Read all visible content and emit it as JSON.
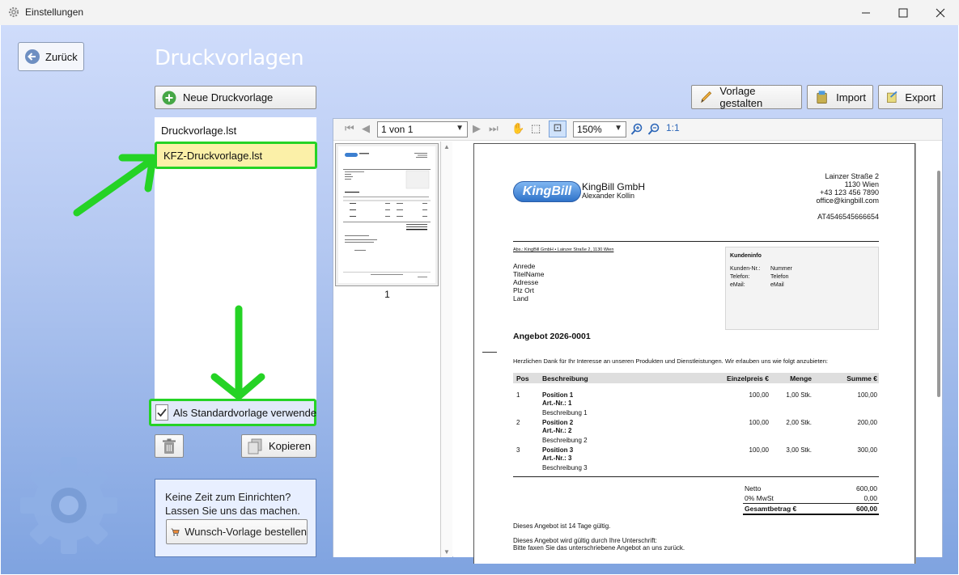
{
  "window": {
    "title": "Einstellungen",
    "minimize_icon": "minimize-icon",
    "maximize_icon": "maximize-icon",
    "close_icon": "close-icon"
  },
  "nav": {
    "back_label": "Zurück"
  },
  "page_title": "Druckvorlagen",
  "toolbar": {
    "new_label": "Neue Druckvorlage",
    "design_label": "Vorlage gestalten",
    "import_label": "Import",
    "export_label": "Export"
  },
  "templates": {
    "items": [
      {
        "label": "Druckvorlage.lst"
      },
      {
        "label": "KFZ-Druckvorlage.lst"
      }
    ],
    "selected_index": 1
  },
  "default_checkbox": {
    "label": "Als Standardvorlage verwende",
    "checked": true
  },
  "actions": {
    "copy_label": "Kopieren"
  },
  "info": {
    "line1": "Keine Zeit zum Einrichten?",
    "line2": "Lassen Sie uns das machen.",
    "order_label": "Wunsch-Vorlage bestellen"
  },
  "preview": {
    "page_select": "1 von 1",
    "zoom_select": "150%",
    "zoom_reset": "1:1",
    "thumb_page_number": "1"
  },
  "document": {
    "company": "KingBill GmbH",
    "logo_text": "KingBill",
    "contact_name": "Alexander Kollin",
    "address": [
      "Lainzer Straße 2",
      "1130 Wien",
      "+43 123 456 7890",
      "office@kingbill.com"
    ],
    "vat_id": "AT4546545666654",
    "sender_line": "Abs.: KingBill GmbH • Lainzer Straße 2, 1130 Wien",
    "recipient": [
      "Anrede",
      "TitelName",
      "Adresse",
      "Plz Ort",
      "Land"
    ],
    "customer_box": {
      "title": "Kundeninfo",
      "rows": [
        {
          "label": "Kunden-Nr.:",
          "value": "Nummer"
        },
        {
          "label": "Telefon:",
          "value": "Telefon"
        },
        {
          "label": "eMail:",
          "value": "eMail"
        }
      ]
    },
    "heading": "Angebot 2026-0001",
    "intro": "Herzlichen Dank für Ihr Interesse an unseren Produkten und Dienstleistungen. Wir erlauben uns wie folgt anzubieten:",
    "columns": [
      "Pos",
      "Beschreibung",
      "Einzelpreis €",
      "Menge",
      "Summe €"
    ],
    "positions": [
      {
        "pos": "1",
        "name": "Position 1",
        "art": "Art.-Nr.: 1",
        "desc": "Beschreibung 1",
        "price": "100,00",
        "qty": "1,00 Stk.",
        "sum": "100,00"
      },
      {
        "pos": "2",
        "name": "Position 2",
        "art": "Art.-Nr.: 2",
        "desc": "Beschreibung 2",
        "price": "100,00",
        "qty": "2,00 Stk.",
        "sum": "200,00"
      },
      {
        "pos": "3",
        "name": "Position 3",
        "art": "Art.-Nr.: 3",
        "desc": "Beschreibung 3",
        "price": "100,00",
        "qty": "3,00 Stk.",
        "sum": "300,00"
      }
    ],
    "totals": [
      {
        "label": "Netto",
        "value": "600,00"
      },
      {
        "label": "0% MwSt",
        "value": "0,00"
      },
      {
        "label": "Gesamtbetrag €",
        "value": "600,00"
      }
    ],
    "validity": "Dieses Angebot ist 14 Tage gültig.",
    "signature_1": "Dieses Angebot wird gültig durch Ihre Unterschrift:",
    "signature_2": "Bitte faxen Sie das unterschriebene Angebot an uns zurück."
  },
  "colors": {
    "highlight": "#25d325",
    "selected_bg": "#fbf0a8",
    "accent": "#2f73c9"
  }
}
